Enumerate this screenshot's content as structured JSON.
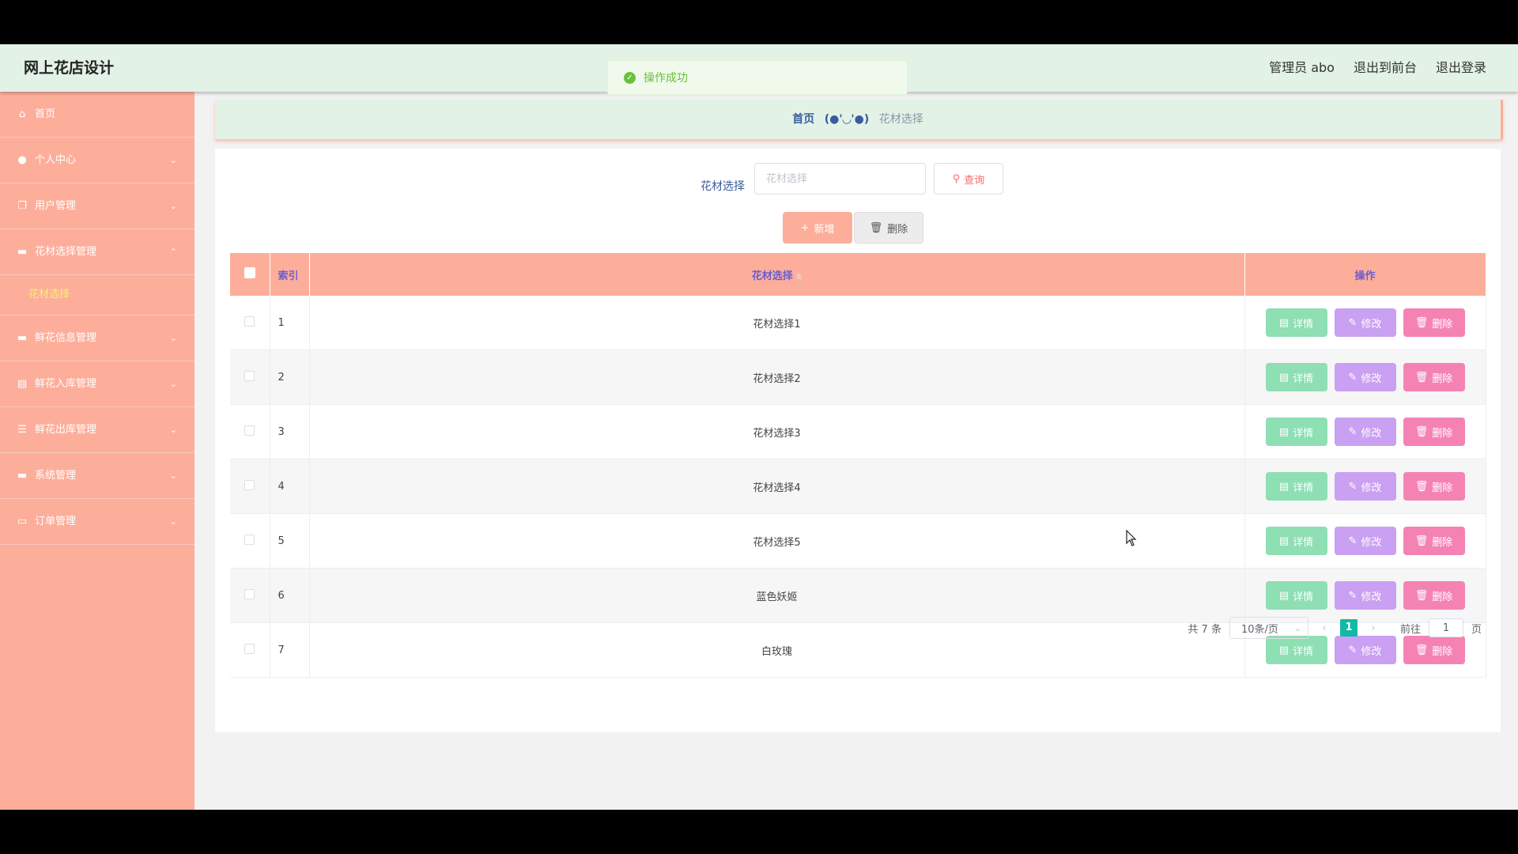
{
  "header": {
    "brand": "网上花店设计",
    "admin": "管理员 abo",
    "front": "退出到前台",
    "logout": "退出登录"
  },
  "toast": {
    "message": "操作成功"
  },
  "sidebar": {
    "items": [
      {
        "label": "首页",
        "icon": "home-icon"
      },
      {
        "label": "个人中心",
        "icon": "user-icon"
      },
      {
        "label": "用户管理",
        "icon": "copy-icon"
      },
      {
        "label": "花材选择管理",
        "icon": "chat-icon"
      },
      {
        "label": "鲜花信息管理",
        "icon": "chat-icon"
      },
      {
        "label": "鲜花入库管理",
        "icon": "briefcase-icon"
      },
      {
        "label": "鲜花出库管理",
        "icon": "list-icon"
      },
      {
        "label": "系统管理",
        "icon": "chat-icon"
      },
      {
        "label": "订单管理",
        "icon": "message-icon"
      }
    ],
    "active_sub": "花材选择"
  },
  "breadcrumb": {
    "home": "首页",
    "separator": "(●'◡'●)",
    "current": "花材选择"
  },
  "search": {
    "label": "花材选择",
    "placeholder": "花材选择",
    "value": "",
    "query_label": "查询"
  },
  "toolbar": {
    "add_label": "新增",
    "delete_label": "删除"
  },
  "table": {
    "headers": [
      "索引",
      "花材选择",
      "操作"
    ],
    "rows": [
      {
        "index": "1",
        "name": "花材选择1"
      },
      {
        "index": "2",
        "name": "花材选择2"
      },
      {
        "index": "3",
        "name": "花材选择3"
      },
      {
        "index": "4",
        "name": "花材选择4"
      },
      {
        "index": "5",
        "name": "花材选择5"
      },
      {
        "index": "6",
        "name": "蓝色妖姬"
      },
      {
        "index": "7",
        "name": "白玫瑰"
      }
    ],
    "row_actions": {
      "detail": "详情",
      "edit": "修改",
      "delete": "删除"
    }
  },
  "pagination": {
    "total": "共 7 条",
    "page_size": "10条/页",
    "current_page": "1",
    "goto_prefix": "前往",
    "goto_value": "1",
    "goto_suffix": "页"
  },
  "colors": {
    "sidebar": "#fdae9b",
    "header": "#e2f2e6",
    "detail": "#8edfb3",
    "edit": "#c9a0f2",
    "delete": "#f483b4",
    "active_page": "#14b8a6"
  }
}
